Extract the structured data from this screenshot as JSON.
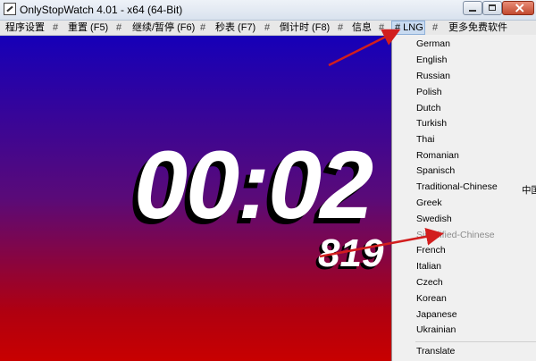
{
  "window": {
    "title": "OnlyStopWatch 4.01 - x64 (64-Bit)"
  },
  "menu": {
    "items": [
      {
        "label": "程序设置"
      },
      {
        "label": "#"
      },
      {
        "label": "重置 (F5)"
      },
      {
        "label": "#"
      },
      {
        "label": "继续/暂停 (F6)"
      },
      {
        "label": "#"
      },
      {
        "label": "秒表 (F7)"
      },
      {
        "label": "#"
      },
      {
        "label": "倒计时 (F8)"
      },
      {
        "label": "#"
      },
      {
        "label": "信息"
      },
      {
        "label": "#"
      },
      {
        "label": "# LNG"
      },
      {
        "label": "#"
      },
      {
        "label": "更多免费软件"
      }
    ]
  },
  "display": {
    "time": "00:02",
    "millis": "819",
    "gradient_colors": [
      "#1600b8",
      "#5a0a78",
      "#c80000"
    ]
  },
  "language_menu": {
    "items": [
      {
        "label": "German",
        "disabled": false
      },
      {
        "label": "English",
        "disabled": false
      },
      {
        "label": "Russian",
        "disabled": false
      },
      {
        "label": "Polish",
        "disabled": false
      },
      {
        "label": "Dutch",
        "disabled": false
      },
      {
        "label": "Turkish",
        "disabled": false
      },
      {
        "label": "Thai",
        "disabled": false
      },
      {
        "label": "Romanian",
        "disabled": false
      },
      {
        "label": "Spanisch",
        "disabled": false
      },
      {
        "label": "Traditional-Chinese",
        "disabled": false
      },
      {
        "label": "Greek",
        "disabled": false
      },
      {
        "label": "Swedish",
        "disabled": false
      },
      {
        "label": "Simplified-Chinese",
        "disabled": true
      },
      {
        "label": "French",
        "disabled": false
      },
      {
        "label": "Italian",
        "disabled": false
      },
      {
        "label": "Czech",
        "disabled": false
      },
      {
        "label": "Korean",
        "disabled": false
      },
      {
        "label": "Japanese",
        "disabled": false
      },
      {
        "label": "Ukrainian",
        "disabled": false
      },
      {
        "label": "Translate",
        "disabled": false
      }
    ],
    "side_label": "中国"
  },
  "annotation_color": "#d21e1e"
}
